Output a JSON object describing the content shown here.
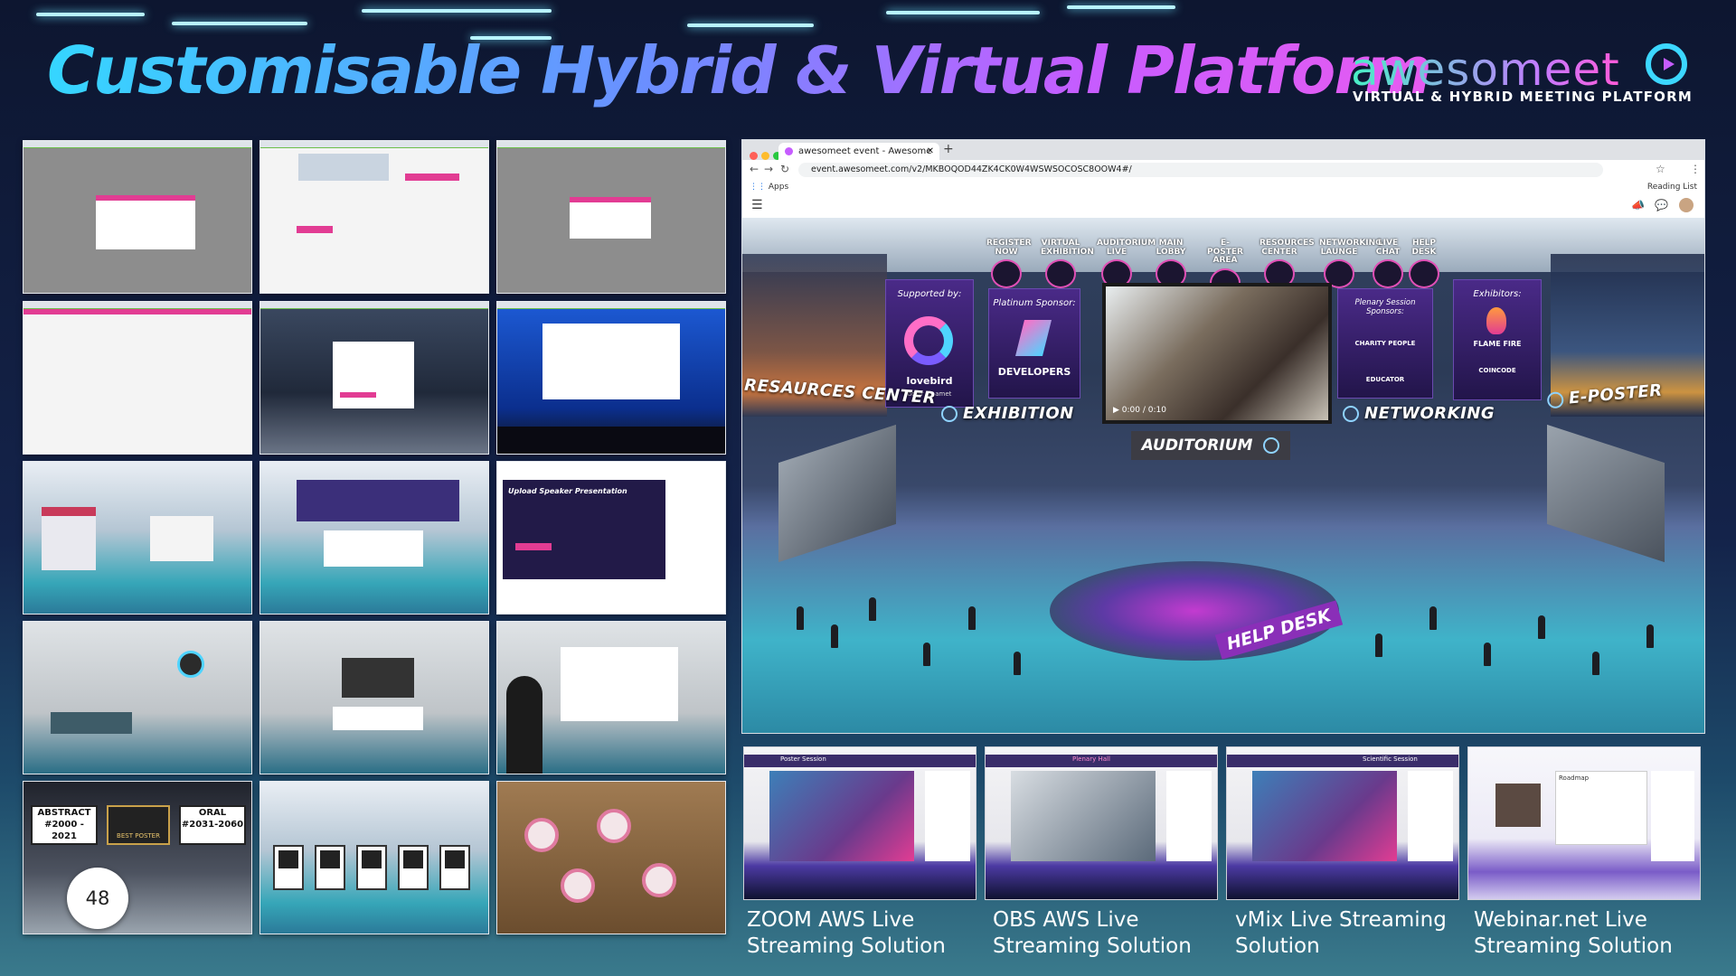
{
  "header": {
    "title": "Customisable Hybrid & Virtual Platform",
    "logo_word": "awesomeet",
    "logo_tagline": "VIRTUAL & HYBRID MEETING PLATFORM"
  },
  "browser": {
    "tab_title": "awesomeet event - Awesome",
    "url": "event.awesomeet.com/v2/MKBOQOD44ZK4CK0W4WSWSOCOSC8OOW4#/",
    "apps_label": "Apps",
    "reading_list": "Reading List"
  },
  "lobby": {
    "menu": [
      {
        "label": "REGISTER NOW"
      },
      {
        "label": "VIRTUAL EXHIBITION"
      },
      {
        "label": "AUDITORIUM LIVE"
      },
      {
        "label": "MAIN LOBBY"
      },
      {
        "label": "E-POSTER AREA"
      },
      {
        "label": "RESOURCES CENTER"
      },
      {
        "label": "NETWORKING LAUNGE"
      },
      {
        "label": "LIVE CHAT"
      },
      {
        "label": "HELP DESK"
      }
    ],
    "banners": {
      "supported_by": "Supported by:",
      "lovebird": "lovebird",
      "lovebird_sub": "dolor sit amet",
      "platinum": "Platinum Sponsor:",
      "developers": "DEVELOPERS",
      "plenary": "Plenary Session Sponsors:",
      "charity": "CHARITY PEOPLE",
      "educator": "EDUCATOR",
      "exhibitors": "Exhibitors:",
      "flame": "FLAME FIRE",
      "coincode": "COINCODE"
    },
    "video_time": "0:00 / 0:10",
    "signs": {
      "resources": "RESAURCES CENTER",
      "exhibition": "EXHIBITION",
      "networking": "NETWORKING",
      "eposter": "E-POSTER",
      "auditorium": "AUDITORIUM",
      "helpdesk": "HELP DESK"
    }
  },
  "thumbnails_left": {
    "abstract": "ABSTRACT",
    "abstract_years": "#2000 - 2021",
    "best_poster": "BEST POSTER",
    "oral": "ORAL",
    "oral_years": "#2031-2060",
    "upload": "Upload Speaker Presentation"
  },
  "streaming": [
    {
      "line1": "ZOOM AWS Live",
      "line2": "Streaming Solution"
    },
    {
      "line1": "OBS AWS Live",
      "line2": "Streaming Solution"
    },
    {
      "line1": "vMix Live Streaming",
      "line2": "Solution"
    },
    {
      "line1": "Webinar.net Live",
      "line2": "Streaming Solution"
    }
  ],
  "stream_header": {
    "poster": "Poster Session",
    "plenary": "Plenary Hall",
    "scientific": "Scientific Session",
    "roadmap": "Roadmap"
  },
  "page_number": "48",
  "colors": {
    "accent_pink": "#e23c93",
    "accent_cyan": "#35d6ff",
    "accent_purple": "#c65cff"
  }
}
